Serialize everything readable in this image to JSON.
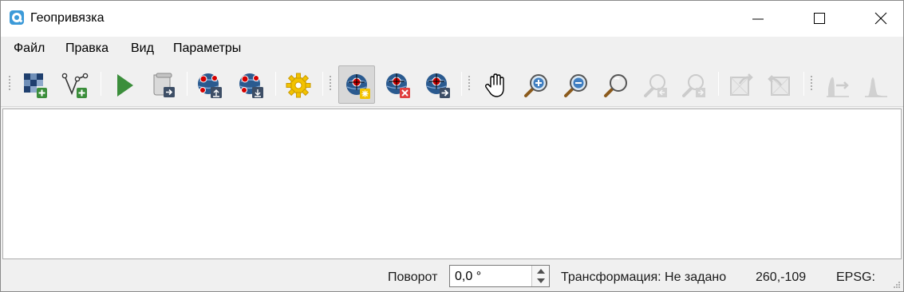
{
  "window": {
    "title": "Геопривязка",
    "app_icon": "qgis-icon"
  },
  "menu": {
    "items": [
      "Файл",
      "Правка",
      "Вид",
      "Параметры"
    ]
  },
  "toolbar": {
    "buttons": [
      {
        "icon": "open-raster-icon",
        "enabled": true
      },
      {
        "icon": "open-vector-icon",
        "enabled": true
      },
      {
        "icon": "start-georeferencing-icon",
        "enabled": true
      },
      {
        "icon": "generate-gdal-script-icon",
        "enabled": true
      },
      {
        "icon": "load-gcp-points-icon",
        "enabled": true
      },
      {
        "icon": "save-gcp-points-icon",
        "enabled": true
      },
      {
        "icon": "transformation-settings-icon",
        "enabled": true
      },
      {
        "icon": "add-point-icon",
        "enabled": true,
        "active": true
      },
      {
        "icon": "delete-point-icon",
        "enabled": true
      },
      {
        "icon": "move-gcp-point-icon",
        "enabled": true
      },
      {
        "icon": "pan-icon",
        "enabled": true
      },
      {
        "icon": "zoom-in-icon",
        "enabled": true
      },
      {
        "icon": "zoom-out-icon",
        "enabled": true
      },
      {
        "icon": "zoom-to-layer-icon",
        "enabled": true
      },
      {
        "icon": "zoom-last-icon",
        "enabled": false
      },
      {
        "icon": "zoom-next-icon",
        "enabled": false
      },
      {
        "icon": "link-georeferencer-to-qgis-icon",
        "enabled": false
      },
      {
        "icon": "link-qgis-to-georeferencer-icon",
        "enabled": false
      },
      {
        "icon": "full-histogram-stretch-icon",
        "enabled": false
      },
      {
        "icon": "local-histogram-stretch-icon",
        "enabled": false
      }
    ]
  },
  "status": {
    "rotation_label": "Поворот",
    "rotation_value": "0,0 °",
    "transformation_text": "Трансформация: Не задано",
    "coordinates": "260,-109",
    "epsg_label": "EPSG:"
  },
  "colors": {
    "titlebar_bg": "#ffffff",
    "chrome_bg": "#f0f0f0",
    "canvas_bg": "#ffffff",
    "accent_green": "#3b8e3b",
    "gcp_red": "#d40000",
    "globe_blue": "#2a5a8f"
  }
}
